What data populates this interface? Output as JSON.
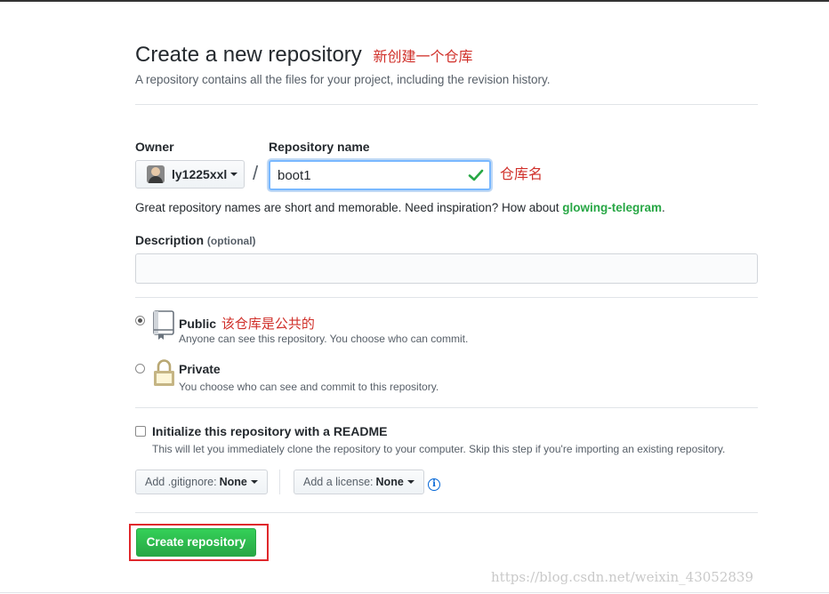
{
  "header": {
    "title": "Create a new repository",
    "title_annotation": "新创建一个仓库",
    "subtitle": "A repository contains all the files for your project, including the revision history."
  },
  "owner": {
    "label": "Owner",
    "value": "ly1225xxl"
  },
  "repo_name": {
    "label": "Repository name",
    "value": "boot1",
    "annotation": "仓库名"
  },
  "separator": "/",
  "hint": {
    "text": "Great repository names are short and memorable. Need inspiration? How about ",
    "suggestion": "glowing-telegram",
    "end": "."
  },
  "description": {
    "label": "Description",
    "optional": "(optional)",
    "value": ""
  },
  "visibility": {
    "public": {
      "title": "Public",
      "annotation": "该仓库是公共的",
      "desc": "Anyone can see this repository. You choose who can commit.",
      "selected": true
    },
    "private": {
      "title": "Private",
      "desc": "You choose who can see and commit to this repository.",
      "selected": false
    }
  },
  "init": {
    "title": "Initialize this repository with a README",
    "desc": "This will let you immediately clone the repository to your computer. Skip this step if you're importing an existing repository.",
    "checked": false
  },
  "gitignore": {
    "label": "Add .gitignore:",
    "value": "None"
  },
  "license": {
    "label": "Add a license:",
    "value": "None"
  },
  "info_icon": "i",
  "submit": {
    "label": "Create repository"
  },
  "watermark": "https://blog.csdn.net/weixin_43052839",
  "colors": {
    "annotation": "#d0302a",
    "primary_button": "#28a745",
    "highlight_box": "#e0282c",
    "suggestion": "#28a745"
  }
}
